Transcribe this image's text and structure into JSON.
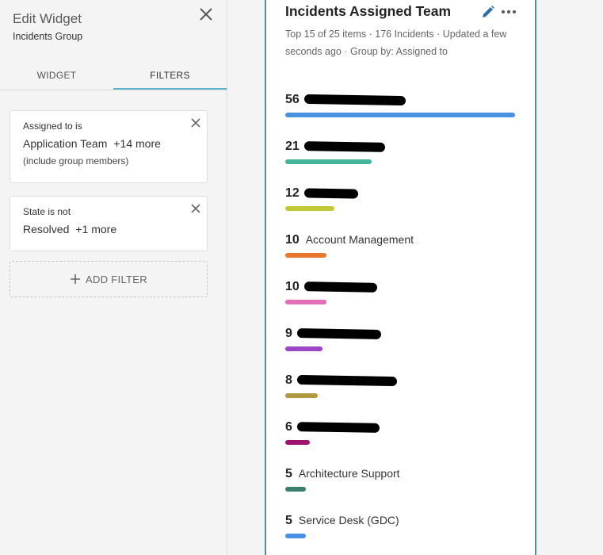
{
  "panel": {
    "title": "Edit Widget",
    "subtitle": "Incidents Group",
    "tabs": [
      {
        "label": "WIDGET",
        "active": false
      },
      {
        "label": "FILTERS",
        "active": true
      }
    ],
    "filters": [
      {
        "label": "Assigned to is",
        "value": "Application Team",
        "more": "+14 more",
        "note": "(include group members)"
      },
      {
        "label": "State is not",
        "value": "Resolved",
        "more": "+1 more"
      }
    ],
    "add_filter_label": "ADD FILTER"
  },
  "widget": {
    "title": "Incidents Assigned Team",
    "meta": "Top 15 of 25 items · 176 Incidents · Updated a few seconds ago · Group by: Assigned to",
    "items": [
      {
        "count": "56",
        "label": "",
        "value": 56,
        "color": "#4a90e2"
      },
      {
        "count": "21",
        "label": "",
        "value": 21,
        "color": "#44b59b"
      },
      {
        "count": "12",
        "label": "",
        "value": 12,
        "color": "#c0c935"
      },
      {
        "count": "10",
        "label": "Account Management",
        "value": 10,
        "color": "#e8772e"
      },
      {
        "count": "10",
        "label": "",
        "value": 10,
        "color": "#e46fb9"
      },
      {
        "count": "9",
        "label": "",
        "value": 9,
        "color": "#9b46c9"
      },
      {
        "count": "8",
        "label": "",
        "value": 8,
        "color": "#b29840"
      },
      {
        "count": "6",
        "label": "",
        "value": 6,
        "color": "#a0136d"
      },
      {
        "count": "5",
        "label": "Architecture Support",
        "value": 5,
        "color": "#3b7e70"
      },
      {
        "count": "5",
        "label": "Service Desk (GDC)",
        "value": 5,
        "color": "#4a90e2"
      }
    ]
  },
  "icons": {
    "close": "close-icon",
    "edit": "pencil-icon",
    "more": "more-horizontal-icon",
    "add": "plus-icon"
  }
}
